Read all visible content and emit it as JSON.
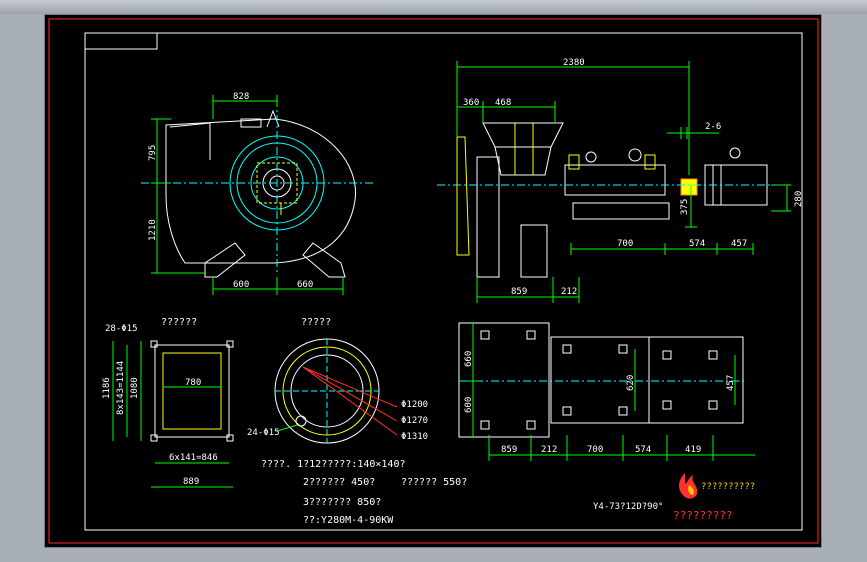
{
  "drawing": {
    "side_view": {
      "top_width": "828",
      "left_heights": [
        "795",
        "1210"
      ],
      "bottom_widths": [
        "600",
        "660"
      ]
    },
    "front_view": {
      "overall_length": "2380",
      "top_dims": [
        "360",
        "468"
      ],
      "gap": "2-6",
      "shaft_height": "375",
      "motor_height": "280",
      "base_dims": [
        "859",
        "212",
        "700",
        "574",
        "457"
      ]
    },
    "inlet_flange": {
      "title": "??????",
      "hole_label": "28-Φ15",
      "height_outer": "1186",
      "height_pitch": "8x143=1144",
      "height_inner": "1080",
      "width_inner": "780",
      "width_pitch": "6x141=846",
      "width_outer": "889"
    },
    "outlet_flange": {
      "title": "?????",
      "hole_label": "24-Φ15",
      "diameters": [
        "Φ1200",
        "Φ1270",
        "Φ1310"
      ]
    },
    "plan_view": {
      "left_dims": [
        "660",
        "600"
      ],
      "mid_dim": "620",
      "right_dim": "457",
      "bottom_dims": [
        "859",
        "212",
        "700",
        "574",
        "419"
      ]
    },
    "notes": [
      "????. 1?12?????:140×140?",
      "2?????? 450?",
      "?????? 550?",
      "3??????? 850?",
      "??:Y280M-4-90KW"
    ],
    "model": "Y4-73?12D?90°",
    "logo_text": "??????????",
    "company": "?????????",
    "colors": {
      "border": "#ff2a2a",
      "dimension": "#00ff00",
      "outline": "#ffffff",
      "center": "#00ffff",
      "part": "#ffff00"
    }
  }
}
